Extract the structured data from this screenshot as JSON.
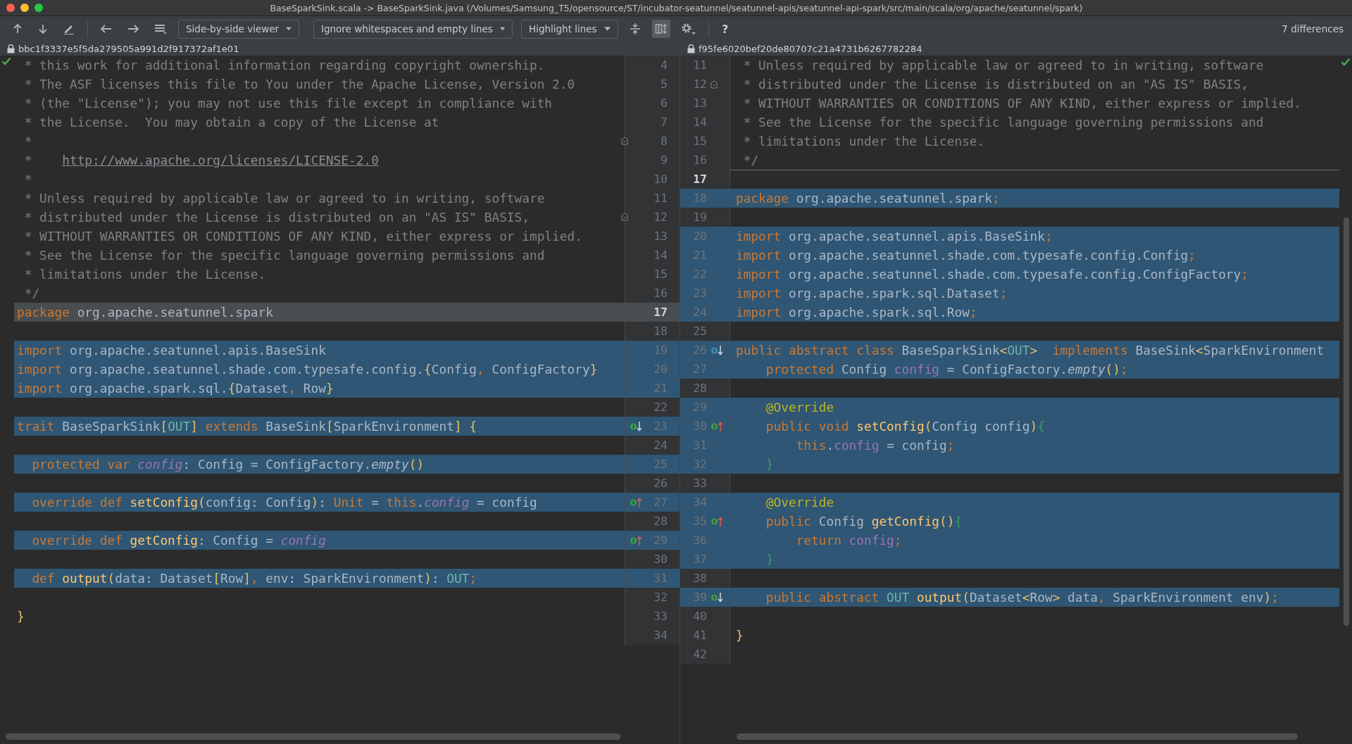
{
  "window": {
    "title": "BaseSparkSink.scala -> BaseSparkSink.java (/Volumes/Samsung_T5/opensource/ST/incubator-seatunnel/seatunnel-apis/seatunnel-api-spark/src/main/scala/org/apache/seatunnel/spark)"
  },
  "toolbar": {
    "viewer_mode": "Side-by-side viewer",
    "whitespace_mode": "Ignore whitespaces and empty lines",
    "highlight_mode": "Highlight lines",
    "sync_scroll_on": true,
    "help": "?",
    "differences": "7 differences"
  },
  "left": {
    "revision": "bbc1f3337e5f5da279505a991d2f917372af1e01",
    "inspection_ok": true,
    "lines": [
      {
        "n": "4",
        "kind": "same",
        "tokens": [
          {
            "kind": "cm",
            "text": " * this work for additional information regarding copyright ownership."
          }
        ]
      },
      {
        "n": "5",
        "kind": "same",
        "tokens": [
          {
            "kind": "cm",
            "text": " * The ASF licenses this file to You under the Apache License, Version 2.0"
          }
        ]
      },
      {
        "n": "6",
        "kind": "same",
        "tokens": [
          {
            "kind": "cm",
            "text": " * (the \"License\"); you may not use this file except in compliance with"
          }
        ]
      },
      {
        "n": "7",
        "kind": "same",
        "tokens": [
          {
            "kind": "cm",
            "text": " * the License.  You may obtain a copy of the License at"
          }
        ]
      },
      {
        "n": "8",
        "kind": "same",
        "marker": {
          "kind": "fold"
        },
        "tokens": [
          {
            "kind": "cm",
            "text": " *"
          }
        ]
      },
      {
        "n": "9",
        "kind": "same",
        "tokens": [
          {
            "kind": "cm",
            "text": " *    "
          },
          {
            "kind": "url",
            "text": "http://www.apache.org/licenses/LICENSE-2.0"
          }
        ]
      },
      {
        "n": "10",
        "kind": "same",
        "tokens": [
          {
            "kind": "cm",
            "text": " *"
          }
        ]
      },
      {
        "n": "11",
        "kind": "same",
        "tokens": [
          {
            "kind": "cm",
            "text": " * Unless required by applicable law or agreed to in writing, software"
          }
        ]
      },
      {
        "n": "12",
        "kind": "same",
        "marker": {
          "kind": "fold"
        },
        "tokens": [
          {
            "kind": "cm",
            "text": " * distributed under the License is distributed on an \"AS IS\" BASIS,"
          }
        ]
      },
      {
        "n": "13",
        "kind": "same",
        "tokens": [
          {
            "kind": "cm",
            "text": " * WITHOUT WARRANTIES OR CONDITIONS OF ANY KIND, either express or implied."
          }
        ]
      },
      {
        "n": "14",
        "kind": "same",
        "tokens": [
          {
            "kind": "cm",
            "text": " * See the License for the specific language governing permissions and"
          }
        ]
      },
      {
        "n": "15",
        "kind": "same",
        "tokens": [
          {
            "kind": "cm",
            "text": " * limitations under the License."
          }
        ]
      },
      {
        "n": "16",
        "kind": "same",
        "tokens": [
          {
            "kind": "cm",
            "text": " */"
          }
        ]
      },
      {
        "n": "17",
        "kind": "ignored",
        "tokens": [
          {
            "kind": "kw",
            "text": "package"
          },
          {
            "kind": "id",
            "text": " org.apache.seatunnel.spark"
          }
        ]
      },
      {
        "n": "18",
        "kind": "same"
      },
      {
        "n": "19",
        "kind": "changed",
        "tokens": [
          {
            "kind": "kw",
            "text": "import"
          },
          {
            "kind": "id",
            "text": " org.apache.seatunnel.apis.BaseSink"
          }
        ]
      },
      {
        "n": "20",
        "kind": "changed",
        "tokens": [
          {
            "kind": "kw",
            "text": "import"
          },
          {
            "kind": "id",
            "text": " org.apache.seatunnel.shade.com.typesafe.config."
          },
          {
            "kind": "br",
            "text": "{"
          },
          {
            "kind": "id",
            "text": "Config"
          },
          {
            "kind": "kw",
            "text": ","
          },
          {
            "kind": "id",
            "text": " ConfigFactory"
          },
          {
            "kind": "br",
            "text": "}"
          }
        ]
      },
      {
        "n": "21",
        "kind": "changed",
        "tokens": [
          {
            "kind": "kw",
            "text": "import"
          },
          {
            "kind": "id",
            "text": " org.apache.spark.sql."
          },
          {
            "kind": "br",
            "text": "{"
          },
          {
            "kind": "id",
            "text": "Dataset"
          },
          {
            "kind": "kw",
            "text": ","
          },
          {
            "kind": "id",
            "text": " Row"
          },
          {
            "kind": "br",
            "text": "}"
          }
        ]
      },
      {
        "n": "22",
        "kind": "same"
      },
      {
        "n": "23",
        "kind": "changed",
        "marker": {
          "kind": "implemented"
        },
        "tokens": [
          {
            "kind": "kw",
            "text": "trait"
          },
          {
            "kind": "id",
            "text": " BaseSparkSink"
          },
          {
            "kind": "br",
            "text": "["
          },
          {
            "kind": "tp",
            "text": "OUT"
          },
          {
            "kind": "br",
            "text": "]"
          },
          {
            "kind": "kw",
            "text": " extends"
          },
          {
            "kind": "id",
            "text": " BaseSink"
          },
          {
            "kind": "br",
            "text": "["
          },
          {
            "kind": "id",
            "text": "SparkEnvironment"
          },
          {
            "kind": "br",
            "text": "] {"
          }
        ]
      },
      {
        "n": "24",
        "kind": "same"
      },
      {
        "n": "25",
        "kind": "changed",
        "tokens": [
          {
            "kind": "kw",
            "text": "  protected var"
          },
          {
            "kind": "fldi",
            "text": " config"
          },
          {
            "kind": "id",
            "text": ": Config = ConfigFactory."
          },
          {
            "kind": "it",
            "text": "empty"
          },
          {
            "kind": "br",
            "text": "()"
          }
        ]
      },
      {
        "n": "26",
        "kind": "same"
      },
      {
        "n": "27",
        "kind": "changed",
        "marker": {
          "kind": "overriding"
        },
        "tokens": [
          {
            "kind": "kw",
            "text": "  override def"
          },
          {
            "kind": "fn",
            "text": " setConfig"
          },
          {
            "kind": "br",
            "text": "("
          },
          {
            "kind": "id",
            "text": "config: Config"
          },
          {
            "kind": "br",
            "text": ")"
          },
          {
            "kind": "id",
            "text": ": "
          },
          {
            "kind": "kw",
            "text": "Unit"
          },
          {
            "kind": "id",
            "text": " = "
          },
          {
            "kind": "kw",
            "text": "this"
          },
          {
            "kind": "id",
            "text": "."
          },
          {
            "kind": "fldi",
            "text": "config"
          },
          {
            "kind": "id",
            "text": " = config"
          }
        ]
      },
      {
        "n": "28",
        "kind": "same"
      },
      {
        "n": "29",
        "kind": "changed",
        "marker": {
          "kind": "overriding"
        },
        "tokens": [
          {
            "kind": "kw",
            "text": "  override def"
          },
          {
            "kind": "fn",
            "text": " getConfig"
          },
          {
            "kind": "id",
            "text": ": Config = "
          },
          {
            "kind": "fldi",
            "text": "config"
          }
        ]
      },
      {
        "n": "30",
        "kind": "same"
      },
      {
        "n": "31",
        "kind": "changed",
        "tokens": [
          {
            "kind": "kw",
            "text": "  def"
          },
          {
            "kind": "fn",
            "text": " output"
          },
          {
            "kind": "br",
            "text": "("
          },
          {
            "kind": "id",
            "text": "data: Dataset"
          },
          {
            "kind": "br",
            "text": "["
          },
          {
            "kind": "id",
            "text": "Row"
          },
          {
            "kind": "br",
            "text": "]"
          },
          {
            "kind": "kw",
            "text": ","
          },
          {
            "kind": "id",
            "text": " env: SparkEnvironment"
          },
          {
            "kind": "br",
            "text": ")"
          },
          {
            "kind": "id",
            "text": ": "
          },
          {
            "kind": "tp",
            "text": "OUT"
          },
          {
            "kind": "kw",
            "text": ";"
          }
        ]
      },
      {
        "n": "32",
        "kind": "same"
      },
      {
        "n": "33",
        "kind": "same",
        "tokens": [
          {
            "kind": "br",
            "text": "}"
          }
        ]
      },
      {
        "n": "34",
        "kind": "same"
      }
    ]
  },
  "right": {
    "revision": "f95fe6020bef20de80707c21a4731b6267782284",
    "inspection_ok": true,
    "lines": [
      {
        "n": "11",
        "kind": "same",
        "tokens": [
          {
            "kind": "cm",
            "text": " * Unless required by applicable law or agreed to in writing, software"
          }
        ]
      },
      {
        "n": "12",
        "kind": "same",
        "marker": {
          "kind": "fold"
        },
        "tokens": [
          {
            "kind": "cm",
            "text": " * distributed under the License is distributed on an \"AS IS\" BASIS,"
          }
        ]
      },
      {
        "n": "13",
        "kind": "same",
        "tokens": [
          {
            "kind": "cm",
            "text": " * WITHOUT WARRANTIES OR CONDITIONS OF ANY KIND, either express or implied."
          }
        ]
      },
      {
        "n": "14",
        "kind": "same",
        "tokens": [
          {
            "kind": "cm",
            "text": " * See the License for the specific language governing permissions and"
          }
        ]
      },
      {
        "n": "15",
        "kind": "same",
        "tokens": [
          {
            "kind": "cm",
            "text": " * limitations under the License."
          }
        ]
      },
      {
        "n": "16",
        "kind": "same",
        "tokens": [
          {
            "kind": "cm",
            "text": " */"
          }
        ]
      },
      {
        "n": "17",
        "kind": "caret"
      },
      {
        "n": "18",
        "kind": "changed",
        "tokens": [
          {
            "kind": "kw",
            "text": "package"
          },
          {
            "kind": "id",
            "text": " org.apache.seatunnel.spark"
          },
          {
            "kind": "kw",
            "text": ";"
          }
        ]
      },
      {
        "n": "19",
        "kind": "same"
      },
      {
        "n": "20",
        "kind": "changed",
        "tokens": [
          {
            "kind": "kw",
            "text": "import"
          },
          {
            "kind": "id",
            "text": " org.apache.seatunnel.apis.BaseSink"
          },
          {
            "kind": "kw",
            "text": ";"
          }
        ]
      },
      {
        "n": "21",
        "kind": "changed",
        "tokens": [
          {
            "kind": "kw",
            "text": "import"
          },
          {
            "kind": "id",
            "text": " org.apache.seatunnel.shade.com.typesafe.config.Config"
          },
          {
            "kind": "kw",
            "text": ";"
          }
        ]
      },
      {
        "n": "22",
        "kind": "changed",
        "tokens": [
          {
            "kind": "kw",
            "text": "import"
          },
          {
            "kind": "id",
            "text": " org.apache.seatunnel.shade.com.typesafe.config.ConfigFactory"
          },
          {
            "kind": "kw",
            "text": ";"
          }
        ]
      },
      {
        "n": "23",
        "kind": "changed",
        "tokens": [
          {
            "kind": "kw",
            "text": "import"
          },
          {
            "kind": "id",
            "text": " org.apache.spark.sql.Dataset"
          },
          {
            "kind": "kw",
            "text": ";"
          }
        ]
      },
      {
        "n": "24",
        "kind": "changed",
        "tokens": [
          {
            "kind": "kw",
            "text": "import"
          },
          {
            "kind": "id",
            "text": " org.apache.spark.sql.Row"
          },
          {
            "kind": "kw",
            "text": ";"
          }
        ]
      },
      {
        "n": "25",
        "kind": "same"
      },
      {
        "n": "26",
        "kind": "changed",
        "marker": {
          "kind": "class-implemented"
        },
        "tokens": [
          {
            "kind": "kw",
            "text": "public abstract class"
          },
          {
            "kind": "id",
            "text": " BaseSparkSink"
          },
          {
            "kind": "br",
            "text": "<"
          },
          {
            "kind": "tp",
            "text": "OUT"
          },
          {
            "kind": "br",
            "text": ">"
          },
          {
            "kind": "kw",
            "text": "  implements"
          },
          {
            "kind": "id",
            "text": " BaseSink"
          },
          {
            "kind": "br",
            "text": "<"
          },
          {
            "kind": "id",
            "text": "SparkEnvironment"
          }
        ]
      },
      {
        "n": "27",
        "kind": "changed",
        "tokens": [
          {
            "kind": "kw",
            "text": "    protected"
          },
          {
            "kind": "id",
            "text": " Config "
          },
          {
            "kind": "fld",
            "text": "config"
          },
          {
            "kind": "id",
            "text": " = ConfigFactory."
          },
          {
            "kind": "it",
            "text": "empty"
          },
          {
            "kind": "br",
            "text": "()"
          },
          {
            "kind": "kw",
            "text": ";"
          }
        ]
      },
      {
        "n": "28",
        "kind": "same"
      },
      {
        "n": "29",
        "kind": "changed",
        "tokens": [
          {
            "kind": "ann",
            "text": "    @Override"
          }
        ]
      },
      {
        "n": "30",
        "kind": "changed",
        "marker": {
          "kind": "overriding"
        },
        "tokens": [
          {
            "kind": "kw",
            "text": "    public void"
          },
          {
            "kind": "fn",
            "text": " setConfig"
          },
          {
            "kind": "br",
            "text": "("
          },
          {
            "kind": "id",
            "text": "Config config"
          },
          {
            "kind": "br",
            "text": ")"
          },
          {
            "kind": "gb",
            "text": "{"
          }
        ]
      },
      {
        "n": "31",
        "kind": "changed",
        "tokens": [
          {
            "kind": "kw",
            "text": "        this"
          },
          {
            "kind": "id",
            "text": "."
          },
          {
            "kind": "fld",
            "text": "config"
          },
          {
            "kind": "id",
            "text": " = config"
          },
          {
            "kind": "kw",
            "text": ";"
          }
        ]
      },
      {
        "n": "32",
        "kind": "changed",
        "tokens": [
          {
            "kind": "gb",
            "text": "    }"
          }
        ]
      },
      {
        "n": "33",
        "kind": "same"
      },
      {
        "n": "34",
        "kind": "changed",
        "tokens": [
          {
            "kind": "ann",
            "text": "    @Override"
          }
        ]
      },
      {
        "n": "35",
        "kind": "changed",
        "marker": {
          "kind": "overriding"
        },
        "tokens": [
          {
            "kind": "kw",
            "text": "    public"
          },
          {
            "kind": "id",
            "text": " Config "
          },
          {
            "kind": "fn",
            "text": "getConfig"
          },
          {
            "kind": "br",
            "text": "()"
          },
          {
            "kind": "gb",
            "text": "{"
          }
        ]
      },
      {
        "n": "36",
        "kind": "changed",
        "tokens": [
          {
            "kind": "kw",
            "text": "        return"
          },
          {
            "kind": "fld",
            "text": " config"
          },
          {
            "kind": "kw",
            "text": ";"
          }
        ]
      },
      {
        "n": "37",
        "kind": "changed",
        "tokens": [
          {
            "kind": "gb",
            "text": "    }"
          }
        ]
      },
      {
        "n": "38",
        "kind": "same"
      },
      {
        "n": "39",
        "kind": "changed",
        "marker": {
          "kind": "implemented"
        },
        "tokens": [
          {
            "kind": "kw",
            "text": "    public abstract"
          },
          {
            "kind": "tp",
            "text": " OUT"
          },
          {
            "kind": "fn",
            "text": " output"
          },
          {
            "kind": "br",
            "text": "("
          },
          {
            "kind": "id",
            "text": "Dataset"
          },
          {
            "kind": "br",
            "text": "<"
          },
          {
            "kind": "id",
            "text": "Row"
          },
          {
            "kind": "br",
            "text": ">"
          },
          {
            "kind": "id",
            "text": " data"
          },
          {
            "kind": "kw",
            "text": ","
          },
          {
            "kind": "id",
            "text": " SparkEnvironment env"
          },
          {
            "kind": "br",
            "text": ")"
          },
          {
            "kind": "kw",
            "text": ";"
          }
        ]
      },
      {
        "n": "40",
        "kind": "same"
      },
      {
        "n": "41",
        "kind": "same",
        "tokens": [
          {
            "kind": "br",
            "text": "}"
          }
        ]
      },
      {
        "n": "42",
        "kind": "same"
      }
    ]
  }
}
